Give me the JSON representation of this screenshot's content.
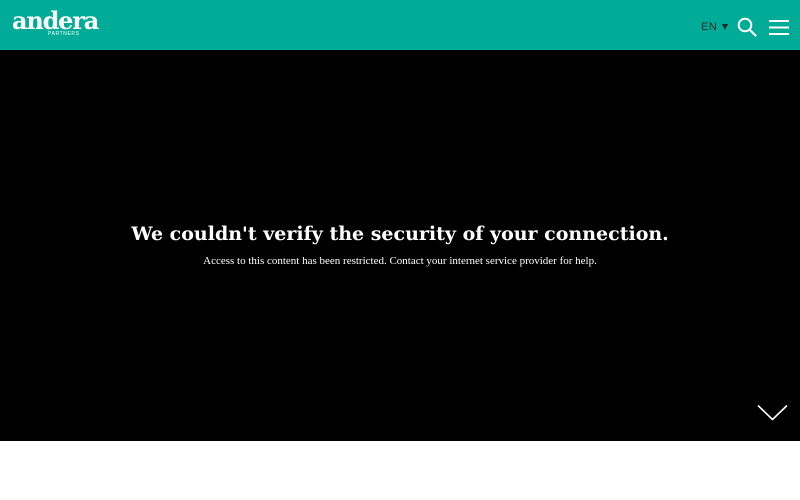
{
  "header": {
    "logo_text": "andera",
    "logo_subtext": "PARTNERS",
    "language": "EN",
    "search_icon": "search-icon",
    "menu_icon": "hamburger-menu-icon",
    "background_color": "#00ab97"
  },
  "hero": {
    "title": "We couldn't verify the security of your connection.",
    "message": "Access to this content has been restricted. Contact your internet service provider for help.",
    "scroll_icon": "chevron-down-icon",
    "background_color": "#000000"
  }
}
